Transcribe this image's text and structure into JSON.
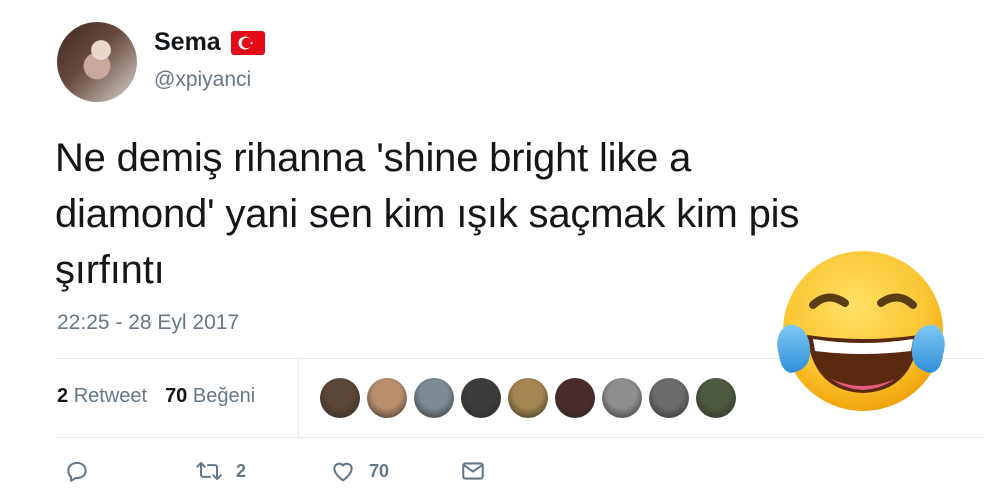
{
  "user": {
    "display_name": "Sema",
    "flag": "turkey-flag-icon",
    "handle": "@xpiyanci"
  },
  "tweet": {
    "text_lines": [
      "Ne demiş rihanna 'shine bright like a",
      "diamond' yani sen kim ışık saçmak kim pis",
      "şırfıntı"
    ],
    "timestamp": "22:25 - 28 Eyl 2017"
  },
  "stats": {
    "retweet_count": "2",
    "retweet_label": "Retweet",
    "like_count": "70",
    "like_label": "Beğeni"
  },
  "likers": [
    {
      "name": "liker-avatar-1",
      "color": "#5a4634"
    },
    {
      "name": "liker-avatar-2",
      "color": "#b98e6c"
    },
    {
      "name": "liker-avatar-3",
      "color": "#7d8a94"
    },
    {
      "name": "liker-avatar-4",
      "color": "#3c3c3c"
    },
    {
      "name": "liker-avatar-5",
      "color": "#a48450"
    },
    {
      "name": "liker-avatar-6",
      "color": "#4a2b2b"
    },
    {
      "name": "liker-avatar-7",
      "color": "#8e8e8e"
    },
    {
      "name": "liker-avatar-8",
      "color": "#6b6b6b"
    },
    {
      "name": "liker-avatar-9",
      "color": "#4d5a3e"
    }
  ],
  "actions": {
    "reply_icon": "reply-icon",
    "retweet_icon": "retweet-icon",
    "retweet_count": "2",
    "like_icon": "heart-icon",
    "like_count": "70",
    "dm_icon": "envelope-icon"
  },
  "overlay": {
    "emoji": "face-with-tears-of-joy-emoji"
  },
  "colors": {
    "text": "#14171a",
    "secondary": "#657786",
    "divider": "#e6ecf0",
    "flag_red": "#e30a17"
  }
}
